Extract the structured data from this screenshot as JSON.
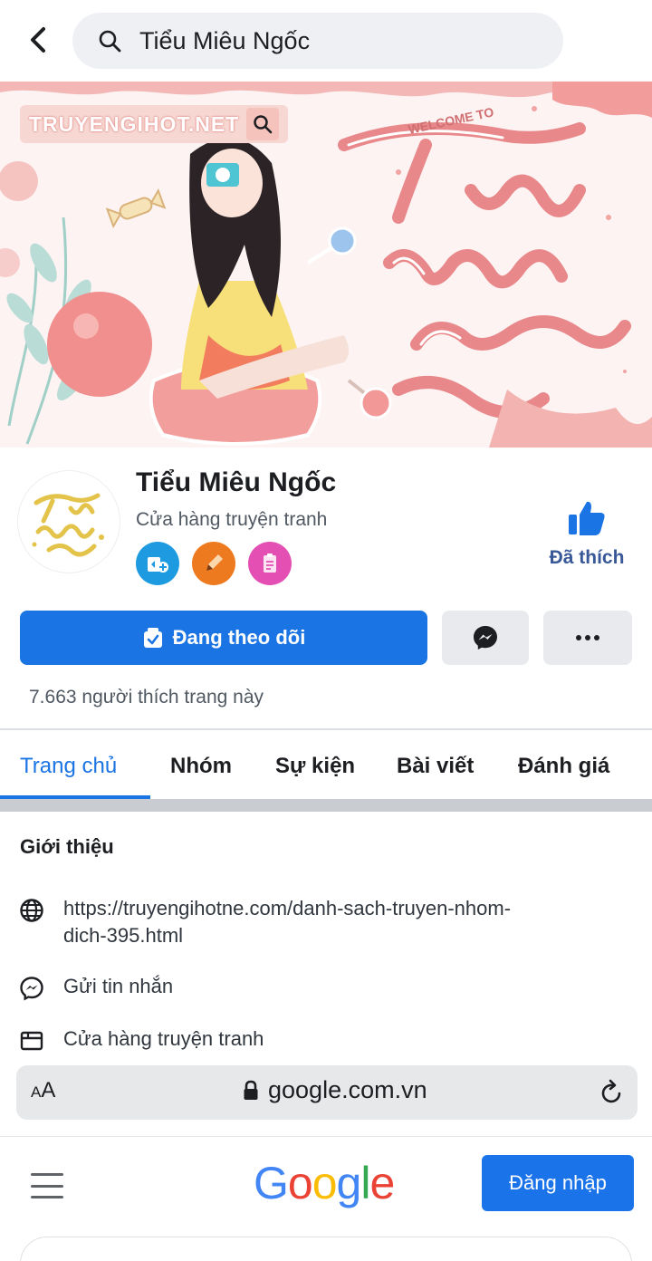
{
  "header": {
    "search_query": "Tiểu Miêu Ngốc",
    "back_icon": "chevron-left-icon",
    "search_icon": "search-icon"
  },
  "cover": {
    "watermark_text": "TRUYENGIHOT.NET",
    "welcome_text": "WELCOME TO",
    "title_art_lines": [
      "Tiểu",
      "miêu",
      "ngốc"
    ],
    "accent_color": "#e88a8c"
  },
  "profile": {
    "name": "Tiểu Miêu Ngốc",
    "category": "Cửa hàng truyện tranh",
    "avatar_text": "tiểu miêu ngốc",
    "badges": [
      {
        "name": "top-fan-badge-icon",
        "color": "#1e9be0"
      },
      {
        "name": "pencil-badge-icon",
        "color": "#ee7a1f"
      },
      {
        "name": "clipboard-badge-icon",
        "color": "#e34fb2"
      }
    ],
    "liked_label": "Đã thích",
    "liked_icon": "thumbs-up-icon"
  },
  "actions": {
    "following_label": "Đang theo dõi",
    "messenger_icon": "messenger-icon",
    "more_icon": "more-dots-icon"
  },
  "likes_text": "7.663 người thích trang này",
  "tabs": [
    {
      "label": "Trang chủ",
      "active": true
    },
    {
      "label": "Nhóm"
    },
    {
      "label": "Sự kiện"
    },
    {
      "label": "Bài viết"
    },
    {
      "label": "Đánh giá"
    }
  ],
  "intro": {
    "title": "Giới thiệu",
    "website": "https://truyengihotne.com/danh-sach-truyen-nhom-dich-395.html",
    "website_line1": "https://truyengihotne.com/danh-sach-truyen-nhom-",
    "website_line2": "dich-395.html",
    "message": "Gửi tin nhắn",
    "category": "Cửa hàng truyện tranh"
  },
  "browser": {
    "text_size": "AA",
    "url": "google.com.vn"
  },
  "google": {
    "logo": "Google",
    "signin_label": "Đăng nhập",
    "brand_colors": [
      "#4285F4",
      "#EA4335",
      "#FBBC05",
      "#4285F4",
      "#34A853",
      "#EA4335"
    ]
  }
}
